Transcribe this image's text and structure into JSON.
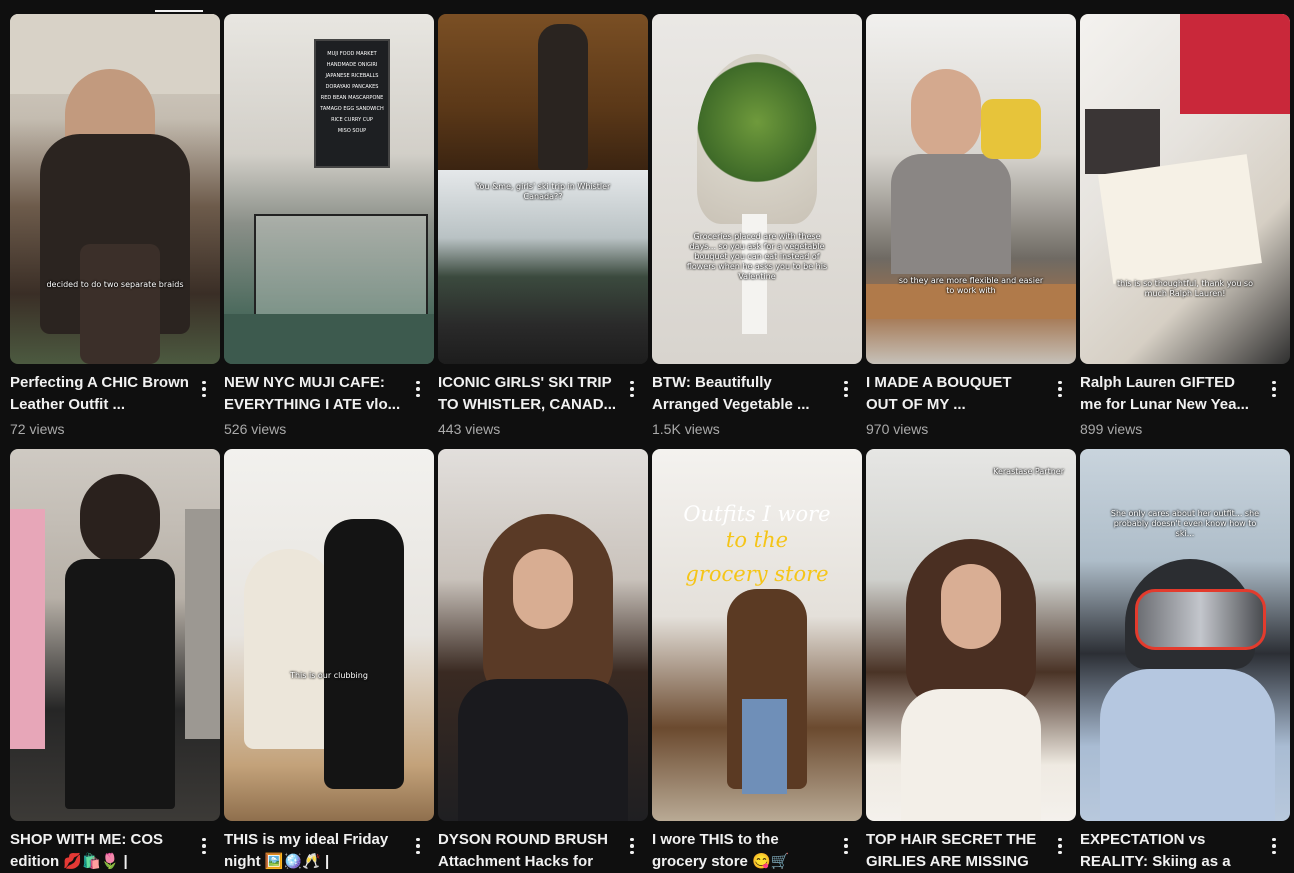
{
  "videos": [
    {
      "title": "Perfecting A CHIC Brown Leather Outfit ...",
      "views": "72 views",
      "caption": "decided to do two separate braids"
    },
    {
      "title": "NEW NYC MUJI CAFE: EVERYTHING I ATE vlo...",
      "views": "526 views",
      "sign": [
        "MUJI FOOD MARKET",
        "HANDMADE ONIGIRI",
        "JAPANESE RICEBALLS",
        "DORAYAKI PANCAKES",
        "RED BEAN MASCARPONE",
        "TAMAGO EGG SANDWICH",
        "RICE CURRY CUP",
        "MISO SOUP"
      ]
    },
    {
      "title": "ICONIC GIRLS' SKI TRIP TO WHISTLER, CANAD...",
      "views": "443 views",
      "caption": "You &me, girls' ski trip in Whistler Canada??"
    },
    {
      "title": "BTW: Beautifully Arranged Vegetable ...",
      "views": "1.5K views",
      "caption": "Groceries placed are with these days... so you ask for a vegetable bouquet you can eat instead of flowers when he asks you to be his Valentine"
    },
    {
      "title": "I MADE A BOUQUET OUT OF MY ...",
      "views": "970 views",
      "caption": "so they are more flexible and easier to work with"
    },
    {
      "title": "Ralph Lauren GIFTED me for Lunar New Yea...",
      "views": "899 views",
      "caption": "this is so thoughtful, thank you so much Ralph Lauren!"
    },
    {
      "title": "SHOP WITH ME: COS edition 💋🛍️🌷 |",
      "views": ""
    },
    {
      "title": "THIS is my ideal Friday night 🖼️🪩🥂 |",
      "views": "",
      "caption": "This is our clubbing"
    },
    {
      "title": "DYSON ROUND BRUSH Attachment Hacks for",
      "views": ""
    },
    {
      "title": "I wore THIS to the grocery store 😋🛒",
      "views": "",
      "overlay_line1": "Outfits I wore",
      "overlay_line2": "to the",
      "overlay_line3": "grocery store"
    },
    {
      "title": "TOP HAIR SECRET THE GIRLIES ARE MISSING",
      "views": "",
      "caption": "Kerastase Partner"
    },
    {
      "title": "EXPECTATION vs REALITY: Skiing as a",
      "views": "",
      "caption": "She only cares about her outfit... she probably doesn't even know how to ski..."
    }
  ],
  "colors": {
    "background": "#0f0f0f",
    "title": "#f1f1f1",
    "views": "#aaaaaa",
    "overlay_serif_white": "#ffffff",
    "overlay_serif_yellow": "#f5c518"
  }
}
